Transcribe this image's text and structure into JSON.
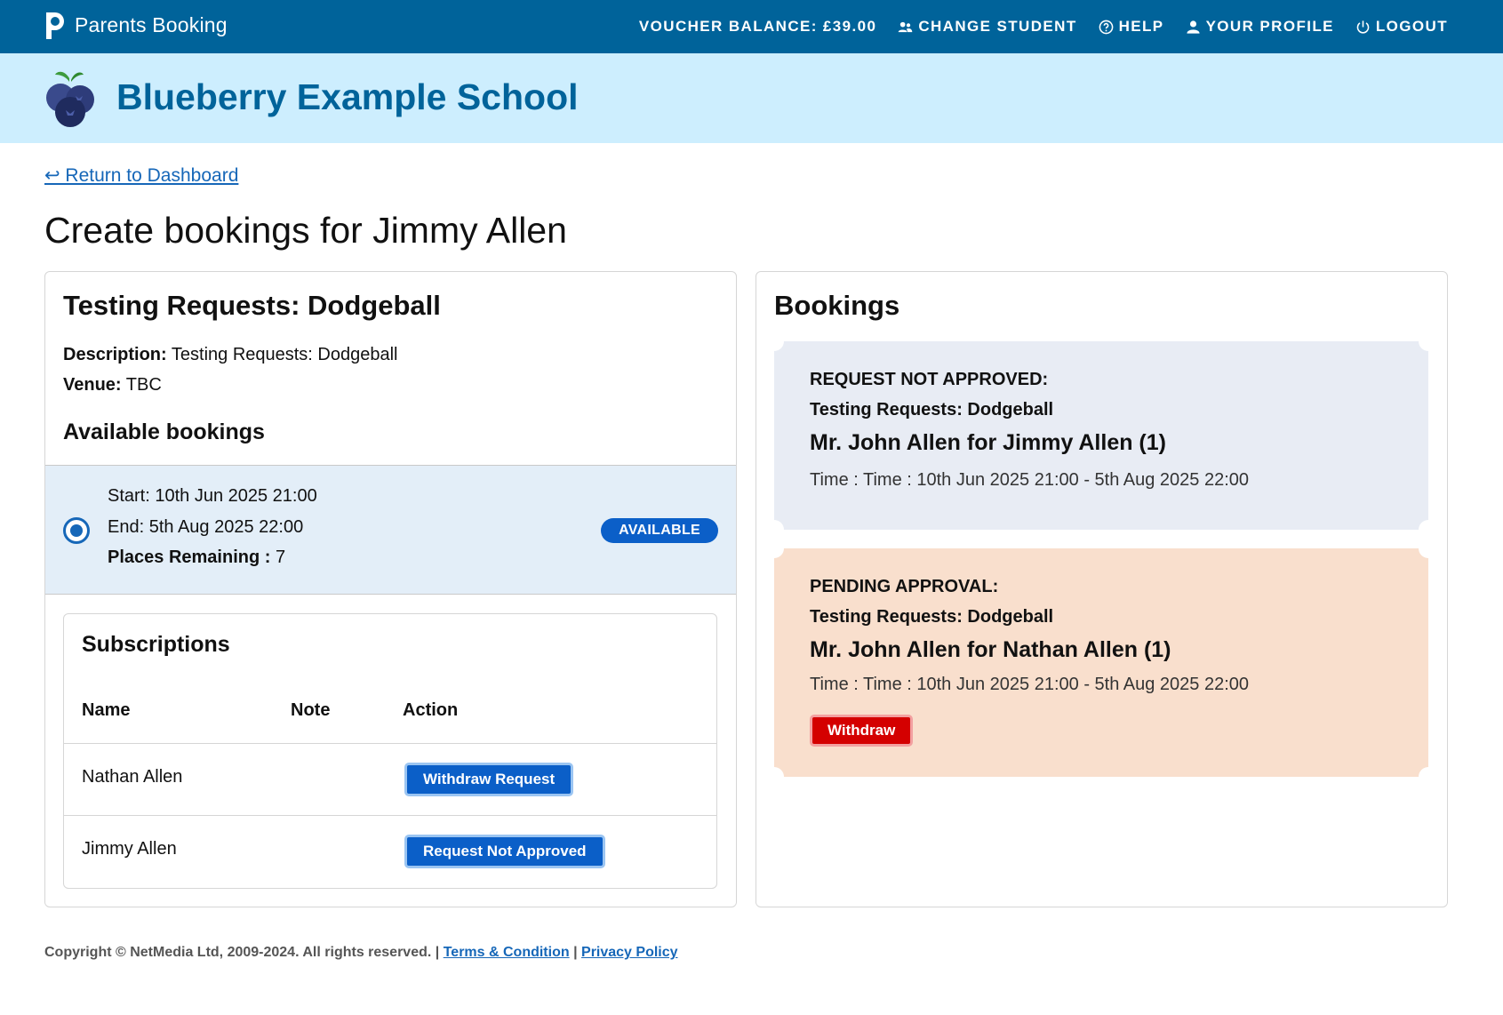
{
  "navbar": {
    "brand": "Parents Booking",
    "items": [
      {
        "label": "VOUCHER BALANCE: £39.00",
        "icon": ""
      },
      {
        "label": "CHANGE STUDENT",
        "icon": "users-icon"
      },
      {
        "label": "HELP",
        "icon": "help-icon"
      },
      {
        "label": "YOUR PROFILE",
        "icon": "user-icon"
      },
      {
        "label": "LOGOUT",
        "icon": "power-icon"
      }
    ]
  },
  "banner": {
    "school_name": "Blueberry Example School"
  },
  "back_link": "↩ Return to Dashboard",
  "page_title": "Create bookings for Jimmy Allen",
  "event": {
    "title": "Testing Requests: Dodgeball",
    "description_label": "Description:",
    "description": "Testing Requests: Dodgeball",
    "venue_label": "Venue:",
    "venue": "TBC",
    "available_heading": "Available bookings",
    "slot": {
      "start": "Start: 10th Jun 2025 21:00",
      "end": "End: 5th Aug 2025 22:00",
      "places_label": "Places Remaining :",
      "places": "7",
      "badge": "AVAILABLE"
    }
  },
  "subscriptions": {
    "title": "Subscriptions",
    "columns": [
      "Name",
      "Note",
      "Action"
    ],
    "rows": [
      {
        "name": "Nathan Allen",
        "note": "",
        "action": "Withdraw Request"
      },
      {
        "name": "Jimmy Allen",
        "note": "",
        "action": "Request Not Approved"
      }
    ]
  },
  "bookings": {
    "title": "Bookings",
    "items": [
      {
        "status": "REQUEST NOT APPROVED:",
        "event": "Testing Requests: Dodgeball",
        "who": "Mr. John Allen for Jimmy Allen (1)",
        "time": "Time : Time : 10th Jun 2025 21:00 - 5th Aug 2025 22:00"
      },
      {
        "status": "PENDING APPROVAL:",
        "event": "Testing Requests: Dodgeball",
        "who": "Mr. John Allen for Nathan Allen (1)",
        "time": "Time : Time : 10th Jun 2025 21:00 - 5th Aug 2025 22:00",
        "action": "Withdraw"
      }
    ]
  },
  "footer": {
    "copyright": "Copyright © NetMedia Ltd, 2009-2024. All rights reserved. |",
    "terms": "Terms & Condition",
    "sep": "|",
    "privacy": "Privacy Policy"
  },
  "colors": {
    "navbar": "#00639a",
    "banner": "#cdeefe",
    "primary_button": "#0b5fc8",
    "danger_button": "#d40000",
    "ticket_grey": "#e8ecf4",
    "ticket_orange": "#f9dfcd"
  }
}
